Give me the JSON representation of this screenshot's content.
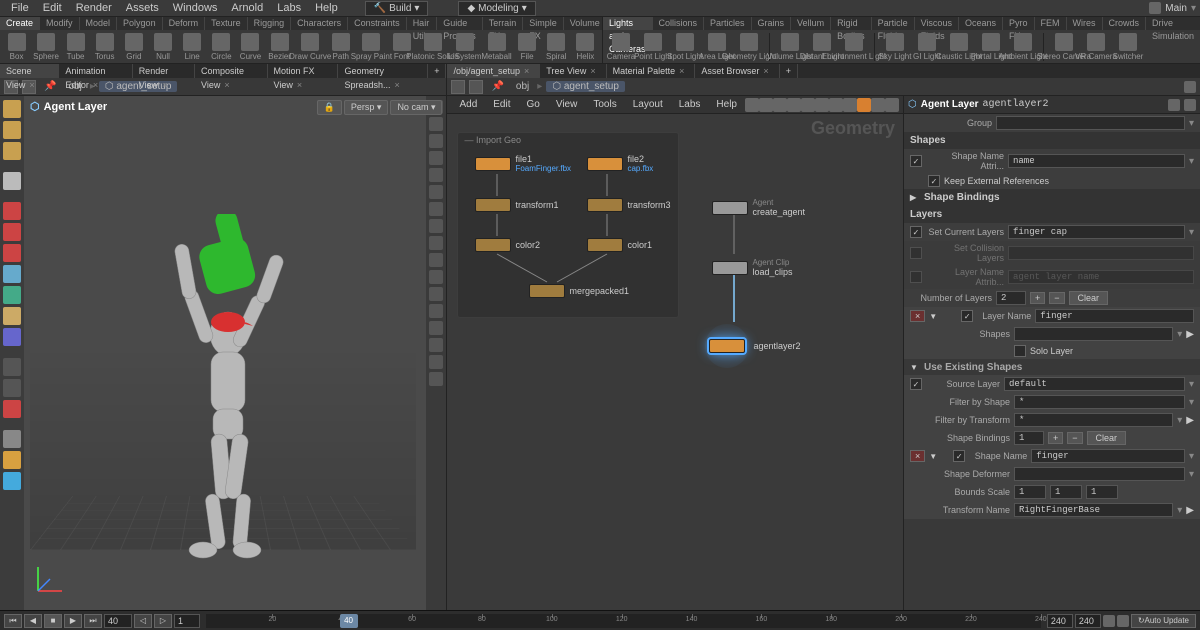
{
  "menubar": [
    "File",
    "Edit",
    "Render",
    "Assets",
    "Windows",
    "Arnold",
    "Labs",
    "Help"
  ],
  "top_center": {
    "build": "Build",
    "modeling": "Modeling"
  },
  "top_right": {
    "context": "Main"
  },
  "shelf_tabs_left": [
    "Create",
    "Modify",
    "Model",
    "Polygon",
    "Deform",
    "Texture",
    "Rigging",
    "Characters",
    "Constraints",
    "Hair Utils",
    "Guide Process",
    "Terrain FX",
    "Simple FX",
    "Volume"
  ],
  "shelf_tools_left": [
    "Box",
    "Sphere",
    "Tube",
    "Torus",
    "Grid",
    "Null",
    "Line",
    "Circle",
    "Curve",
    "Bezier",
    "Draw Curve",
    "Path",
    "Spray Paint",
    "Font",
    "Platonic Solids",
    "L-System",
    "Metaball",
    "File",
    "Spiral",
    "Helix"
  ],
  "shelf_tabs_right": [
    "Lights and Cameras",
    "Collisions",
    "Particles",
    "Grains",
    "Vellum",
    "Rigid Bodies",
    "Particle Fluids",
    "Viscous Fluids",
    "Oceans",
    "Pyro FX",
    "FEM",
    "Wires",
    "Crowds",
    "Drive Simulation"
  ],
  "shelf_tools_right": [
    "Camera",
    "Point Light",
    "Spot Light",
    "Area Light",
    "Geometry Light",
    "|",
    "Volume Light",
    "Distant Light",
    "Environment Light",
    "|",
    "Sky Light",
    "GI Light",
    "Caustic Light",
    "Portal Light",
    "Ambient Light",
    "|",
    "Stereo Camera",
    "VR Camera",
    "Switcher"
  ],
  "left_tabs": [
    "Scene View",
    "Animation Editor",
    "Render View",
    "Composite View",
    "Motion FX View",
    "Geometry Spreadsh..."
  ],
  "right_tabs": [
    "/obj/agent_setup",
    "Tree View",
    "Material Palette",
    "Asset Browser"
  ],
  "path_left": [
    "obj",
    "agent_setup"
  ],
  "path_right": [
    "obj",
    "agent_setup"
  ],
  "viewport": {
    "title": "Agent Layer",
    "persp": "Persp ▾",
    "cam": "No cam ▾"
  },
  "network": {
    "title": "Geometry",
    "menus": [
      "Add",
      "Edit",
      "Go",
      "View",
      "Tools",
      "Layout",
      "Labs",
      "Help"
    ],
    "group_label": "Import Geo",
    "nodes": {
      "file1": {
        "label": "file1",
        "sub": "FoamFinger.fbx"
      },
      "file2": {
        "label": "file2",
        "sub": "cap.fbx"
      },
      "transform1": "transform1",
      "transform3": "transform3",
      "color2": "color2",
      "color1": "color1",
      "mergepacked1": "mergepacked1",
      "create_agent": {
        "pre": "Agent",
        "label": "create_agent"
      },
      "load_clips": {
        "pre": "Agent Clip",
        "label": "load_clips"
      },
      "agentlayer2": "agentlayer2"
    }
  },
  "props": {
    "header": "Agent Layer",
    "node": "agentlayer2",
    "group_label": "Group",
    "shapes_label": "Shapes",
    "shape_name_attrib_label": "Shape Name Attri...",
    "shape_name_attrib": "name",
    "keep_ext": "Keep External References",
    "shape_bindings": "Shape Bindings",
    "layers_label": "Layers",
    "set_current": "Set Current Layers",
    "set_current_val": "finger cap",
    "set_collision": "Set Collision Layers",
    "layer_name_attrib": "Layer Name Attrib...",
    "layer_name_ph": "agent layer name",
    "num_layers_label": "Number of Layers",
    "num_layers": "2",
    "clear": "Clear",
    "layer_name_label": "Layer Name",
    "layer_name": "finger",
    "shapes2": "Shapes",
    "solo": "Solo Layer",
    "use_existing": "Use Existing Shapes",
    "source_layer_label": "Source Layer",
    "source_layer": "default",
    "filter_shape": "Filter by Shape",
    "filter_shape_v": "*",
    "filter_trans": "Filter by Transform",
    "filter_trans_v": "*",
    "shape_bind_label": "Shape Bindings",
    "shape_bind_n": "1",
    "shape_name_label": "Shape Name",
    "shape_name": "finger",
    "shape_deformer": "Shape Deformer",
    "bounds_scale": "Bounds Scale",
    "bounds": [
      "1",
      "1",
      "1"
    ],
    "transform_name_label": "Transform Name",
    "transform_name": "RightFingerBase"
  },
  "timeline": {
    "frame": "40",
    "start": "1",
    "end": "240",
    "range_end": "240",
    "auto": "Auto Update"
  }
}
